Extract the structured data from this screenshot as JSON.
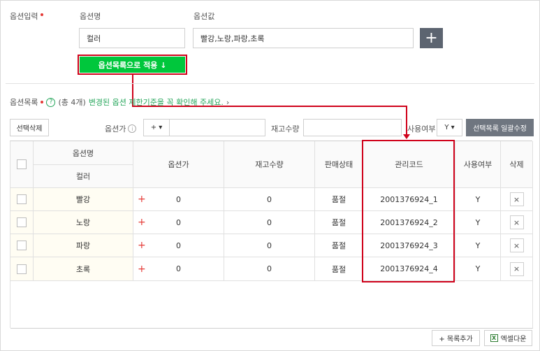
{
  "option_input": {
    "section_label": "옵션입력",
    "name_label": "옵션명",
    "value_label": "옵션값",
    "name_value": "컬러",
    "values_value": "빨강,노랑,파랑,초록",
    "add_symbol": "+",
    "apply_button": "옵션목록으로 적용 ↓"
  },
  "option_list": {
    "section_label": "옵션목록",
    "help_symbol": "?",
    "count_text": "(총 4개)",
    "notice_link": "변경된 옵션 제한기준을 꼭 확인해 주세요.",
    "notice_chevron": "›"
  },
  "toolbar": {
    "delete_selected": "선택삭제",
    "price_label": "옵션가",
    "info_symbol": "i",
    "price_sign": "+ ▾",
    "stock_label": "재고수량",
    "use_label": "사용여부",
    "use_value": "Y ▾",
    "bulk_edit": "선택목록 일괄수정"
  },
  "table": {
    "headers": {
      "option_name": "옵션명",
      "option_sub": "컬러",
      "price": "옵션가",
      "stock": "재고수량",
      "status": "판매상태",
      "code": "관리코드",
      "use": "사용여부",
      "delete": "삭제"
    },
    "rows": [
      {
        "name": "빨강",
        "price": "0",
        "stock": "0",
        "status": "품절",
        "code": "2001376924_1",
        "use": "Y"
      },
      {
        "name": "노랑",
        "price": "0",
        "stock": "0",
        "status": "품절",
        "code": "2001376924_2",
        "use": "Y"
      },
      {
        "name": "파랑",
        "price": "0",
        "stock": "0",
        "status": "품절",
        "code": "2001376924_3",
        "use": "Y"
      },
      {
        "name": "초록",
        "price": "0",
        "stock": "0",
        "status": "품절",
        "code": "2001376924_4",
        "use": "Y"
      }
    ],
    "row_plus": "+",
    "row_delete": "×"
  },
  "footer": {
    "add_list": "+ 목록추가",
    "excel_icon": "X",
    "excel_download": "엑셀다운"
  },
  "colors": {
    "accent_green": "#00c73c",
    "annotation_red": "#d0021b",
    "dark_button": "#5c6470"
  }
}
